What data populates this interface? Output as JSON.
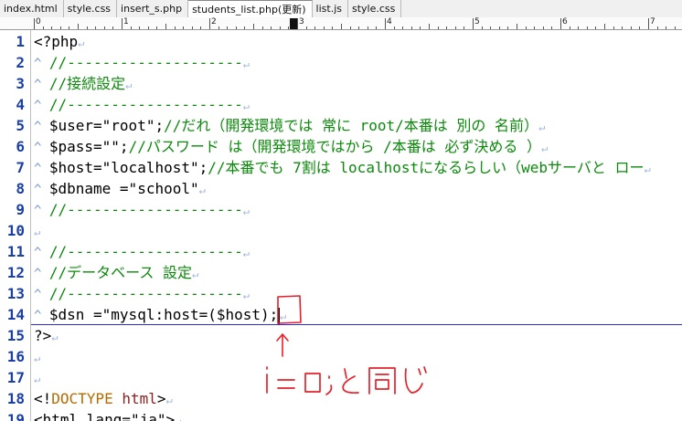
{
  "tabs": [
    {
      "label": "index.html",
      "active": false
    },
    {
      "label": "style.css",
      "active": false
    },
    {
      "label": "insert_s.php",
      "active": false
    },
    {
      "label": "students_list.php(更新)",
      "active": true
    },
    {
      "label": "list.js",
      "active": false
    },
    {
      "label": "style.css",
      "active": false
    }
  ],
  "ruler": {
    "numbers": [
      "0",
      "1",
      "2",
      "3",
      "4",
      "5",
      "6",
      "7"
    ]
  },
  "lines": [
    {
      "n": "1",
      "indent": false,
      "segments": [
        {
          "t": "<?php",
          "c": ""
        }
      ]
    },
    {
      "n": "2",
      "indent": true,
      "segments": [
        {
          "t": "//--------------------",
          "c": "cmt"
        }
      ]
    },
    {
      "n": "3",
      "indent": true,
      "segments": [
        {
          "t": "//接続設定",
          "c": "cmt"
        }
      ]
    },
    {
      "n": "4",
      "indent": true,
      "segments": [
        {
          "t": "//--------------------",
          "c": "cmt"
        }
      ]
    },
    {
      "n": "5",
      "indent": true,
      "segments": [
        {
          "t": "$user=\"root\";",
          "c": ""
        },
        {
          "t": "//だれ（開発環境では 常に root/本番は 別の 名前）",
          "c": "cmt"
        }
      ]
    },
    {
      "n": "6",
      "indent": true,
      "segments": [
        {
          "t": "$pass=\"\";",
          "c": ""
        },
        {
          "t": "//パスワード は（開発環境ではから /本番は 必ず決める ）",
          "c": "cmt"
        }
      ]
    },
    {
      "n": "7",
      "indent": true,
      "segments": [
        {
          "t": "$host=\"localhost\";",
          "c": ""
        },
        {
          "t": "//本番でも 7割は localhostになるらしい（webサーバと ロー",
          "c": "cmt"
        }
      ]
    },
    {
      "n": "8",
      "indent": true,
      "segments": [
        {
          "t": "$dbname =\"school\"",
          "c": ""
        }
      ]
    },
    {
      "n": "9",
      "indent": true,
      "segments": [
        {
          "t": "//--------------------",
          "c": "cmt"
        }
      ]
    },
    {
      "n": "10",
      "indent": false,
      "segments": []
    },
    {
      "n": "11",
      "indent": true,
      "segments": [
        {
          "t": "//--------------------",
          "c": "cmt"
        }
      ]
    },
    {
      "n": "12",
      "indent": true,
      "segments": [
        {
          "t": "//データベース 設定",
          "c": "cmt"
        }
      ]
    },
    {
      "n": "13",
      "indent": true,
      "segments": [
        {
          "t": "//--------------------",
          "c": "cmt"
        }
      ]
    },
    {
      "n": "14",
      "indent": true,
      "segments": [
        {
          "t": "$dsn =\"mysql:host=($host);",
          "c": ""
        }
      ],
      "caret": true
    },
    {
      "n": "15",
      "indent": false,
      "segments": [
        {
          "t": "?>",
          "c": ""
        }
      ]
    },
    {
      "n": "16",
      "indent": false,
      "segments": []
    },
    {
      "n": "17",
      "indent": false,
      "segments": []
    },
    {
      "n": "18",
      "indent": false,
      "segments": [
        {
          "t": "<!",
          "c": ""
        },
        {
          "t": "DOCTYPE",
          "c": "kw"
        },
        {
          "t": " ",
          "c": ""
        },
        {
          "t": "html",
          "c": "tag"
        },
        {
          "t": ">",
          "c": ""
        }
      ]
    },
    {
      "n": "19",
      "indent": false,
      "segments": [
        {
          "t": "<html lang=\"ja\">",
          "c": ""
        }
      ]
    }
  ],
  "colors": {
    "line_number": "#1b3fa8",
    "comment": "#0c8a0c",
    "annotation": "#e8202a",
    "current_line": "#2b2bd0"
  },
  "glyphs": {
    "tab": "^",
    "eol": "↵"
  },
  "annotation": {
    "handwritten": "i=0;と同じ"
  }
}
